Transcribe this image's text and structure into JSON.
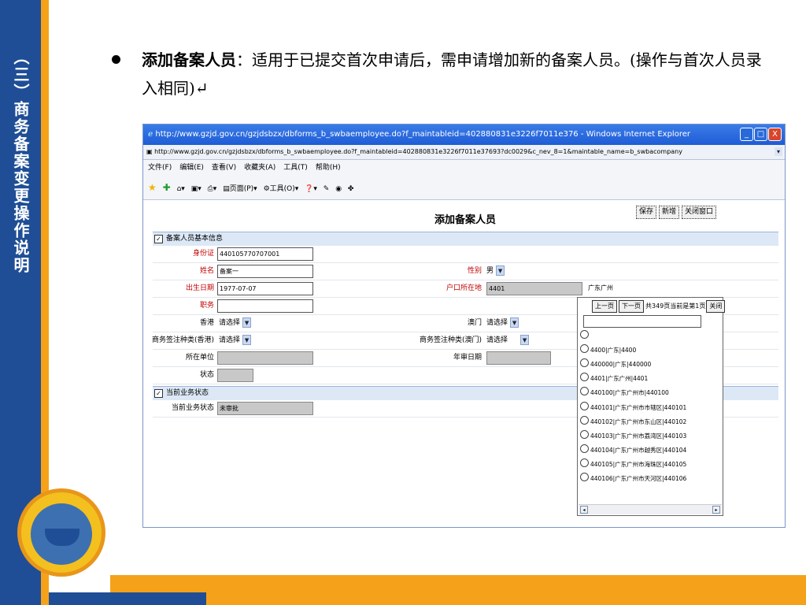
{
  "slide": {
    "sidebar_title": "（三）商务备案变更操作说明",
    "heading_bold": "添加备案人员",
    "heading_rest": "：适用于已提交首次申请后，需申请增加新的备案人员。(操作与首次人员录入相同)↵"
  },
  "browser": {
    "title": "http://www.gzjd.gov.cn/gzjdsbzx/dbforms_b_swbaemployee.do?f_maintableid=402880831e3226f7011e376 - Windows Internet Explorer",
    "address": "http://www.gzjd.gov.cn/gzjdsbzx/dbforms_b_swbaemployee.do?f_maintableid=402880831e3226f7011e37693?dc0029&c_nev_8=1&maintable_name=b_swbacompany",
    "menu": [
      "文件(F)",
      "编辑(E)",
      "查看(V)",
      "收藏夹(A)",
      "工具(T)",
      "帮助(H)"
    ],
    "toolbar": {
      "page": "页面(P)",
      "tools": "工具(O)"
    },
    "win_buttons": {
      "minimize": "_",
      "maximize": "□",
      "close": "X"
    }
  },
  "form": {
    "title": "添加备案人员",
    "buttons": {
      "save": "保存",
      "add": "新增",
      "close": "关闭窗口"
    },
    "section1": "备案人员基本信息",
    "section2": "当前业务状态",
    "labels": {
      "id_card": "身份证",
      "name": "姓名",
      "birth": "出生日期",
      "position": "职务",
      "hongkong": "香港",
      "visa_hk": "商务签注种类(香港)",
      "unit": "所在单位",
      "status": "状态",
      "gender": "性别",
      "hukou": "户口所在地",
      "macau": "澳门",
      "visa_macau": "商务签注种类(澳门)",
      "annual_date": "年审日期",
      "current_status": "当前业务状态"
    },
    "values": {
      "id_card": "440105770707001",
      "name": "备案一",
      "birth": "1977-07-07",
      "gender": "男",
      "hukou_code": "4401",
      "hukou_name": "广东广州",
      "hongkong": "请选择",
      "macau": "请选择",
      "visa_hk": "请选择",
      "visa_macau": "请选择",
      "current_status": "未审批"
    }
  },
  "picker": {
    "prev": "上一页",
    "next": "下一页",
    "info": "共349页当前是第1页",
    "close": "关闭",
    "options": [
      "",
      "4400|广东|4400",
      "440000|广东|440000",
      "4401|广东广州|4401",
      "440100|广东广州市|440100",
      "440101|广东广州市市辖区|440101",
      "440102|广东广州市东山区|440102",
      "440103|广东广州市荔湾区|440103",
      "440104|广东广州市越秀区|440104",
      "440105|广东广州市海珠区|440105",
      "440106|广东广州市天河区|440106"
    ]
  }
}
